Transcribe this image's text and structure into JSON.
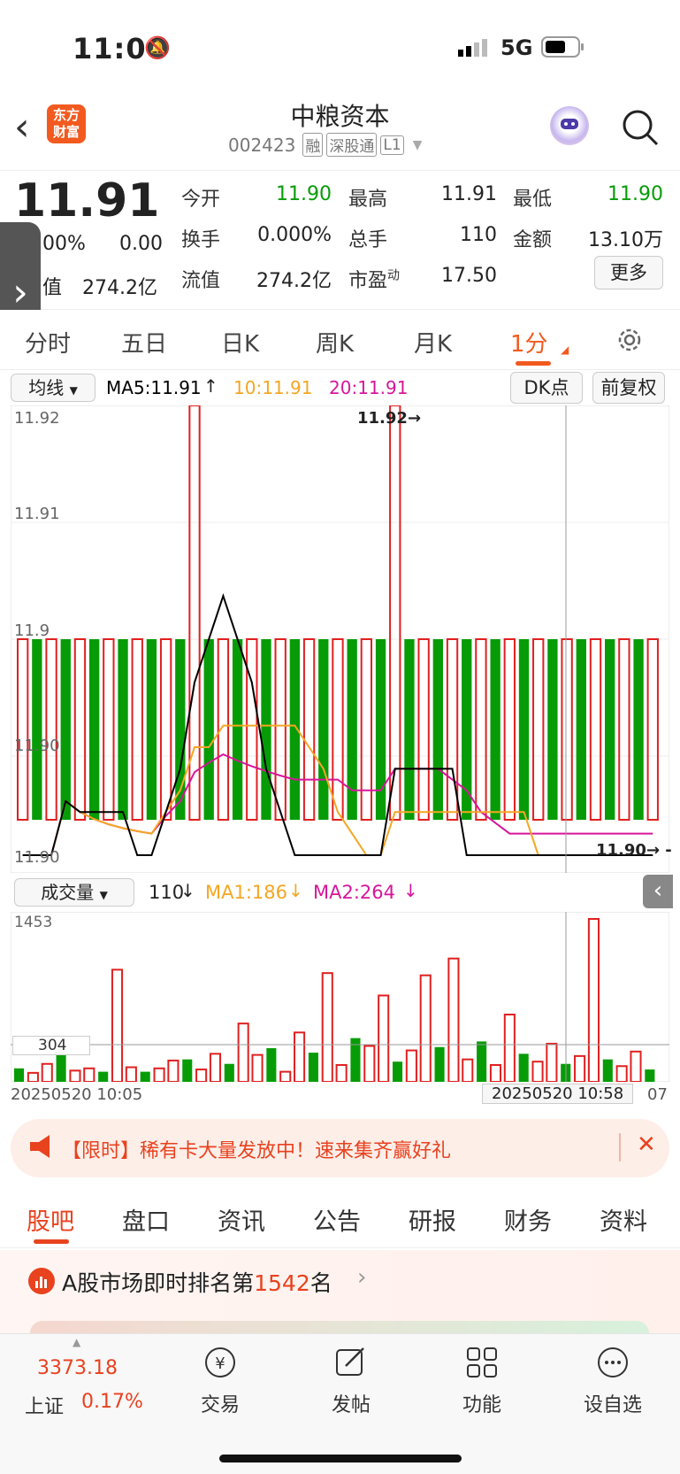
{
  "status": {
    "time": "11:06",
    "network": "5G"
  },
  "header": {
    "title": "中粮资本",
    "code": "002423",
    "badges": [
      "融",
      "深股通",
      "L1"
    ],
    "logo_line1": "东方",
    "logo_line2": "财富"
  },
  "quote": {
    "price": "11.91",
    "change_pct": "00%",
    "change": "0.00",
    "mcap_label": "值",
    "mcap": "274.2亿",
    "rows": [
      {
        "l1": "今开",
        "v1": "11.90",
        "l2": "最高",
        "v2": "11.91",
        "l3": "最低",
        "v3": "11.90"
      },
      {
        "l1": "换手",
        "v1": "0.000%",
        "l2": "总手",
        "v2": "110",
        "l3": "金额",
        "v3": "13.10万"
      },
      {
        "l1": "流值",
        "v1": "274.2亿",
        "l2": "市盈",
        "v2": "17.50",
        "l3": "",
        "v3": ""
      }
    ],
    "pe_sup": "动",
    "more": "更多"
  },
  "tabs": [
    "分时",
    "五日",
    "日K",
    "周K",
    "月K",
    "1分"
  ],
  "chart": {
    "ma_select": "均线",
    "ma5": "MA5:11.91",
    "ma10": "10:11.91",
    "ma20": "20:11.91",
    "dk": "DK点",
    "adj": "前复权",
    "y_labels": [
      "11.92",
      "11.91",
      "11.90",
      "11.90"
    ],
    "y_label_mid": "11.9",
    "max_label": "11.92",
    "last_label": "11.90",
    "vol_select": "成交量",
    "vol_now": "110",
    "ma1": "MA1:186",
    "ma2": "MA2:264",
    "vol_max": "1453",
    "vol_ref": "304",
    "date_start": "20250520 10:05",
    "date_cursor": "20250520 10:58",
    "date_end": "07",
    "colors": {
      "up": "#e02020",
      "down": "#079c07",
      "ma5": "#000000",
      "ma10": "#f5a623",
      "ma20": "#d6169b"
    }
  },
  "chart_data": {
    "type": "candlestick",
    "prices": [
      11.9,
      11.9,
      11.9,
      11.91,
      11.9,
      11.9,
      11.9,
      11.9,
      11.9,
      11.9,
      11.91,
      11.91,
      11.92,
      11.91,
      11.91,
      11.9,
      11.9,
      11.9,
      11.9,
      11.9,
      11.9,
      11.9,
      11.9,
      11.9,
      11.9,
      11.9,
      11.92,
      11.9,
      11.9,
      11.9,
      11.9,
      11.9,
      11.9,
      11.9,
      11.9,
      11.9,
      11.9,
      11.9,
      11.9,
      11.9,
      11.9,
      11.9,
      11.9,
      11.9,
      11.9
    ],
    "volumes": [
      120,
      80,
      160,
      310,
      100,
      120,
      90,
      1000,
      130,
      90,
      120,
      190,
      200,
      110,
      250,
      160,
      520,
      240,
      300,
      90,
      440,
      260,
      970,
      150,
      390,
      320,
      770,
      180,
      280,
      950,
      310,
      1100,
      200,
      360,
      150,
      600,
      250,
      180,
      340,
      160,
      230,
      1453,
      200,
      140,
      270,
      110
    ]
  },
  "promo": {
    "text": "【限时】稀有卡大量发放中！速来集齐赢好礼"
  },
  "subtabs": [
    "股吧",
    "盘口",
    "资讯",
    "公告",
    "研报",
    "财务",
    "资料"
  ],
  "rank": {
    "prefix": "A股市场即时排名第",
    "rank": "1542",
    "suffix": "名"
  },
  "bottom": {
    "index_value": "3373.18",
    "index_name": "上证",
    "index_change": "0.17%",
    "nav": [
      "交易",
      "发帖",
      "功能",
      "设自选"
    ]
  }
}
